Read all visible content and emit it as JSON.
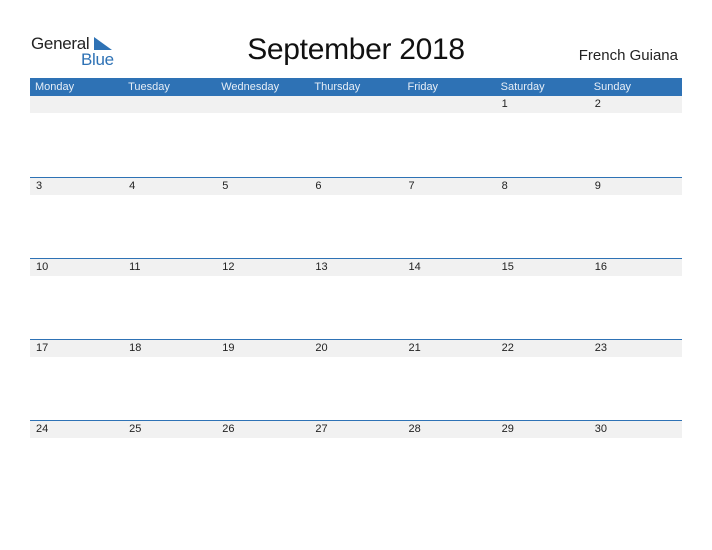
{
  "logo": {
    "line1": "General",
    "line2": "Blue",
    "icon": "triangle-flag-icon"
  },
  "title": "September 2018",
  "country": "French Guiana",
  "colors": {
    "accent": "#2E72B5",
    "date_strip": "#F1F1F1"
  },
  "weekdays": [
    "Monday",
    "Tuesday",
    "Wednesday",
    "Thursday",
    "Friday",
    "Saturday",
    "Sunday"
  ],
  "weeks": [
    [
      "",
      "",
      "",
      "",
      "",
      "1",
      "2"
    ],
    [
      "3",
      "4",
      "5",
      "6",
      "7",
      "8",
      "9"
    ],
    [
      "10",
      "11",
      "12",
      "13",
      "14",
      "15",
      "16"
    ],
    [
      "17",
      "18",
      "19",
      "20",
      "21",
      "22",
      "23"
    ],
    [
      "24",
      "25",
      "26",
      "27",
      "28",
      "29",
      "30"
    ]
  ]
}
